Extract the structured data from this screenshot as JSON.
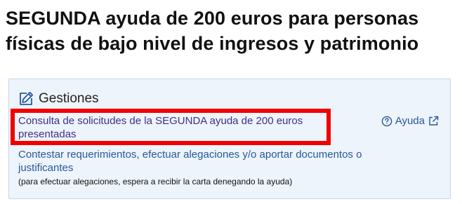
{
  "page": {
    "title": "SEGUNDA ayuda de 200 euros para personas físicas de bajo nivel de ingresos y patrimonio"
  },
  "panel": {
    "title": "Gestiones",
    "link_consulta": "Consulta de solicitudes de la SEGUNDA ayuda de 200 euros presentadas",
    "help_label": "Ayuda",
    "link_contestar": "Contestar requerimientos, efectuar alegaciones y/o aportar documentos o justificantes",
    "note": "(para efectuar alegaciones, espera a recibir la carta denegando la ayuda)"
  },
  "icons": {
    "header": "pencil-edit-icon",
    "help": "question-circle-icon",
    "external": "external-link-icon"
  },
  "colors": {
    "link": "#25599b",
    "visited_link": "#3e2f86",
    "panel_background": "#eef4fb",
    "panel_border": "#c3d6ea",
    "highlight": "#f20000"
  }
}
